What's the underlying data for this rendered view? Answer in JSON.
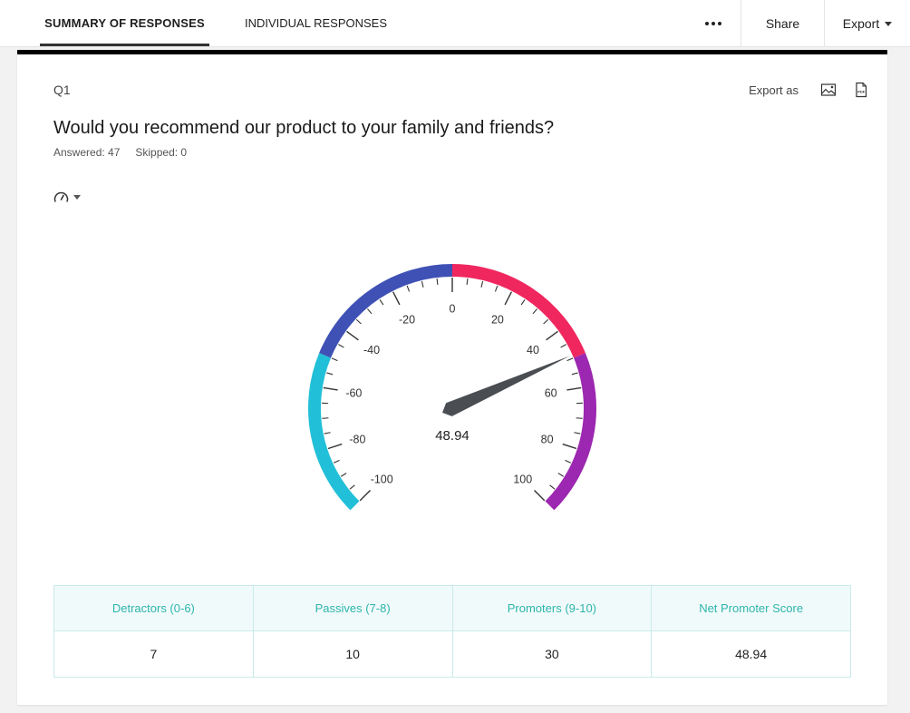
{
  "topbar": {
    "tabs": [
      {
        "label": "SUMMARY OF RESPONSES",
        "active": true
      },
      {
        "label": "INDIVIDUAL RESPONSES",
        "active": false
      }
    ],
    "more_icon": "ellipsis-icon",
    "share_label": "Share",
    "export_label": "Export"
  },
  "question": {
    "number": "Q1",
    "export_as_label": "Export as",
    "export_icons": [
      "image-icon",
      "pdf-icon"
    ],
    "title": "Would you recommend our product to your family and friends?",
    "answered": "Answered: 47",
    "skipped": "Skipped: 0",
    "chart_type_icon": "gauge-icon"
  },
  "chart_data": {
    "type": "gauge",
    "title": "",
    "min": -100,
    "max": 100,
    "value": 48.94,
    "value_label": "48.94",
    "major_ticks": [
      -100,
      -80,
      -60,
      -40,
      -20,
      0,
      20,
      40,
      60,
      80,
      100
    ],
    "tick_labels": [
      "-100",
      "-80",
      "-60",
      "-40",
      "-20",
      "0",
      "20",
      "40",
      "60",
      "80",
      "100"
    ],
    "minor_tick_step": 5,
    "bands": [
      {
        "from": -100,
        "to": -50,
        "color": "#22c0d8"
      },
      {
        "from": -50,
        "to": 0,
        "color": "#3f51b5"
      },
      {
        "from": 0,
        "to": 50,
        "color": "#f0275f"
      },
      {
        "from": 50,
        "to": 100,
        "color": "#9c27b0"
      }
    ],
    "needle_color": "#4a4d52"
  },
  "table": {
    "headers": [
      "Detractors (0-6)",
      "Passives (7-8)",
      "Promoters (9-10)",
      "Net Promoter Score"
    ],
    "values": [
      "7",
      "10",
      "30",
      "48.94"
    ]
  }
}
